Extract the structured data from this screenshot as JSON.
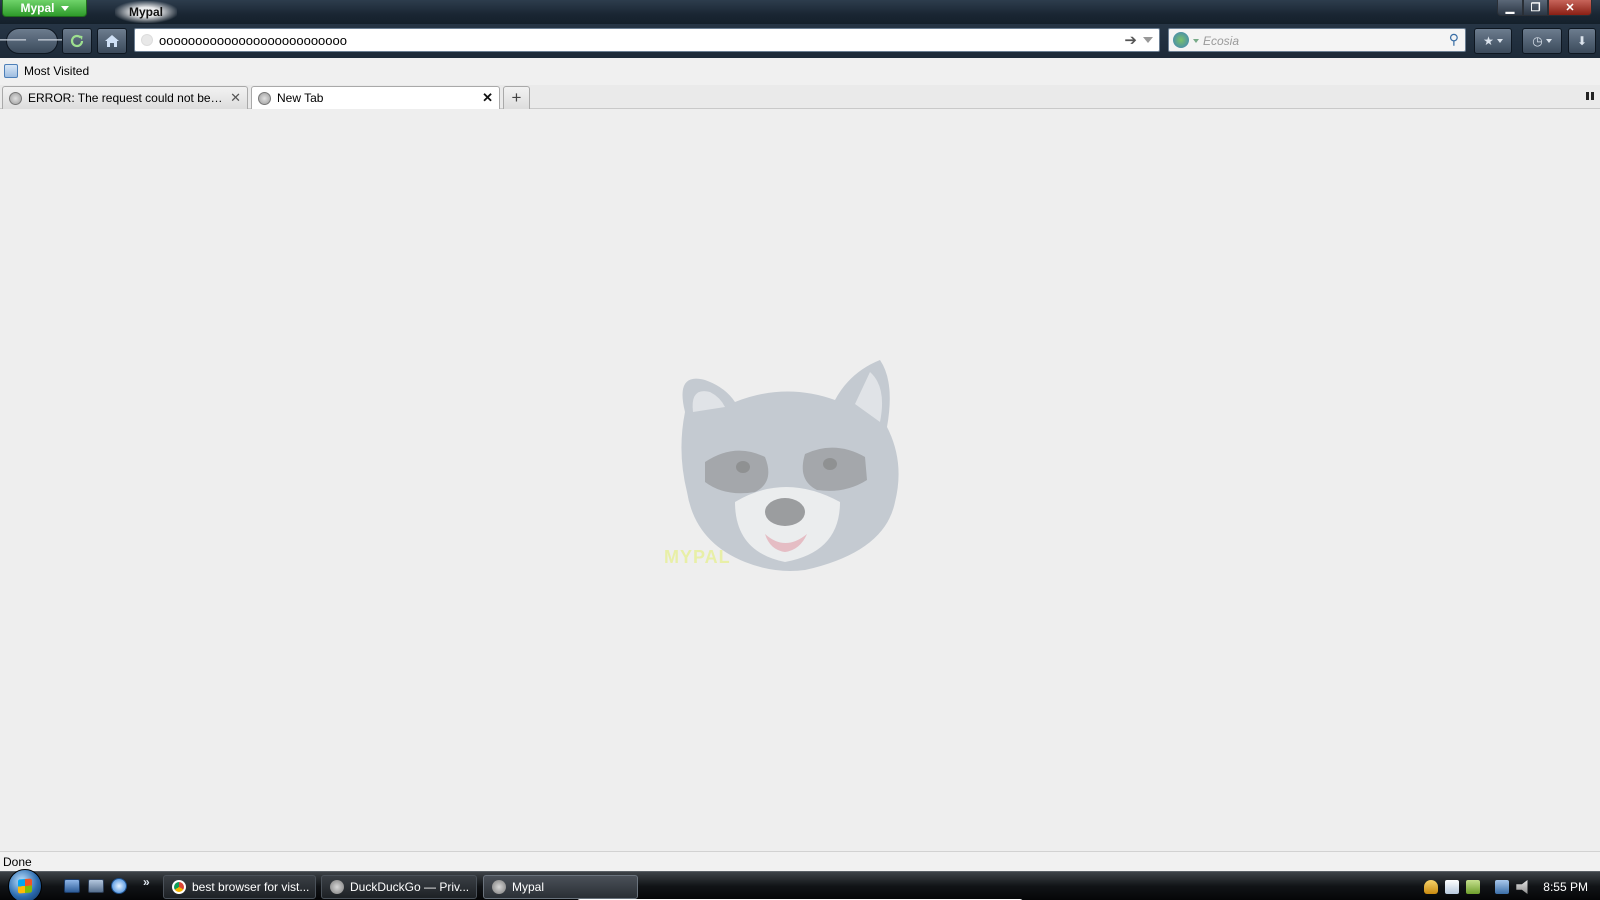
{
  "window": {
    "app_button_label": "Mypal",
    "title": "Mypal",
    "minimize_icon": "minimize-icon",
    "maximize_icon": "restore-icon",
    "close_icon": "close-icon"
  },
  "navbar": {
    "back_icon": "back-arrow-icon",
    "forward_icon": "forward-arrow-icon",
    "reload_icon": "reload-icon",
    "home_icon": "home-icon",
    "url_value": "oooooooooooooooooooooooooo",
    "go_icon": "go-arrow-icon",
    "search_engine_icon": "ecosia-globe-icon",
    "search_placeholder": "Ecosia",
    "search_icon": "magnifier-icon",
    "bookmarks_icon": "bookmarks-star-icon",
    "history_icon": "history-clock-icon",
    "downloads_icon": "download-arrow-icon"
  },
  "bookmarks_bar": {
    "items": [
      {
        "label": "Most Visited",
        "icon": "bookmark-folder-icon"
      }
    ]
  },
  "tabs": [
    {
      "label": "ERROR: The request could not be sati...",
      "icon": "globe-icon",
      "selected": false
    },
    {
      "label": "New Tab",
      "icon": "globe-icon",
      "selected": true
    }
  ],
  "tabbar": {
    "new_tab_label": "+",
    "close_label": "✕"
  },
  "content": {
    "mascot_icon": "raccoon-mascot-icon",
    "mascot_caption": "MYPAL"
  },
  "status": {
    "text": "Done"
  },
  "taskbar": {
    "start_icon": "windows-start-orb-icon",
    "quick_launch": [
      "show-desktop-icon",
      "switch-windows-icon",
      "internet-explorer-icon"
    ],
    "more_label": "»",
    "tasks": [
      {
        "label": "best browser for vist...",
        "icon": "chrome-icon"
      },
      {
        "label": "DuckDuckGo — Priv...",
        "icon": "mypal-globe-icon"
      },
      {
        "label": "Mypal",
        "icon": "mypal-globe-icon",
        "active": true
      }
    ],
    "clock": "8:55 PM"
  },
  "colors": {
    "app_button": "#3ca836",
    "content_background": "#eeeeee",
    "taskbar": "#111417"
  }
}
